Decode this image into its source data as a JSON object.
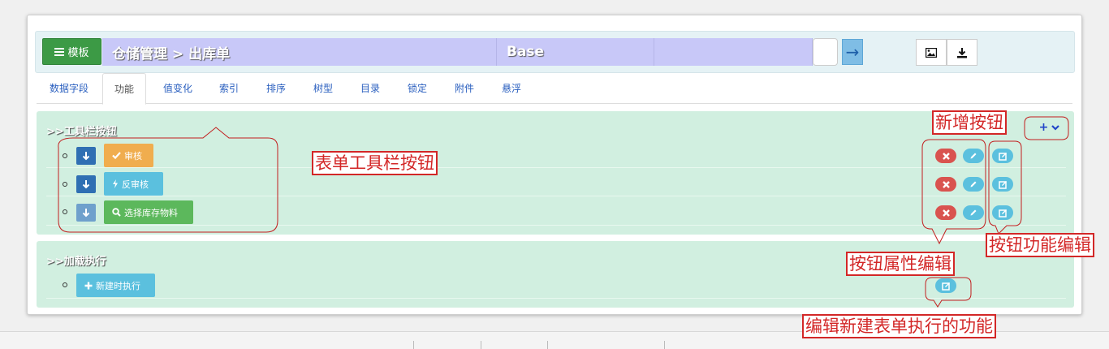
{
  "header": {
    "template_label": "模板",
    "breadcrumb": "仓储管理 > 出库单",
    "base_label": "Base",
    "cell3": "",
    "arrow_glyph": "→"
  },
  "tabs": [
    {
      "label": "数据字段"
    },
    {
      "label": "功能"
    },
    {
      "label": "值变化"
    },
    {
      "label": "索引"
    },
    {
      "label": "排序"
    },
    {
      "label": "树型"
    },
    {
      "label": "目录"
    },
    {
      "label": "锁定"
    },
    {
      "label": "附件"
    },
    {
      "label": "悬浮"
    }
  ],
  "active_tab": "功能",
  "toolbar_section": {
    "title": ">>工具栏按钮",
    "add_glyph": "+",
    "buttons": [
      {
        "label": "审核",
        "icon": "check-icon",
        "color": "#f0ad4e"
      },
      {
        "label": "反审核",
        "icon": "bolt-icon",
        "color": "#5bc0de"
      },
      {
        "label": "选择库存物料",
        "icon": "zoom-icon",
        "color": "#5cb85c"
      }
    ]
  },
  "load_section": {
    "title": ">>加载执行",
    "button_label": "新建时执行",
    "button_icon": "plus-icon",
    "button_color": "#5bc0de"
  },
  "annotations": {
    "toolbar_buttons": "表单工具栏按钮",
    "add_button": "新增按钮",
    "function_edit": "按钮功能编辑",
    "property_edit": "按钮属性编辑",
    "new_form_exec": "编辑新建表单执行的功能"
  },
  "colors": {
    "annotation_red": "#d32727",
    "delete_red": "#d9534f",
    "edit_blue": "#5bc0de",
    "section_green": "#d1efe0",
    "header_purple": "#c8c8f8"
  }
}
